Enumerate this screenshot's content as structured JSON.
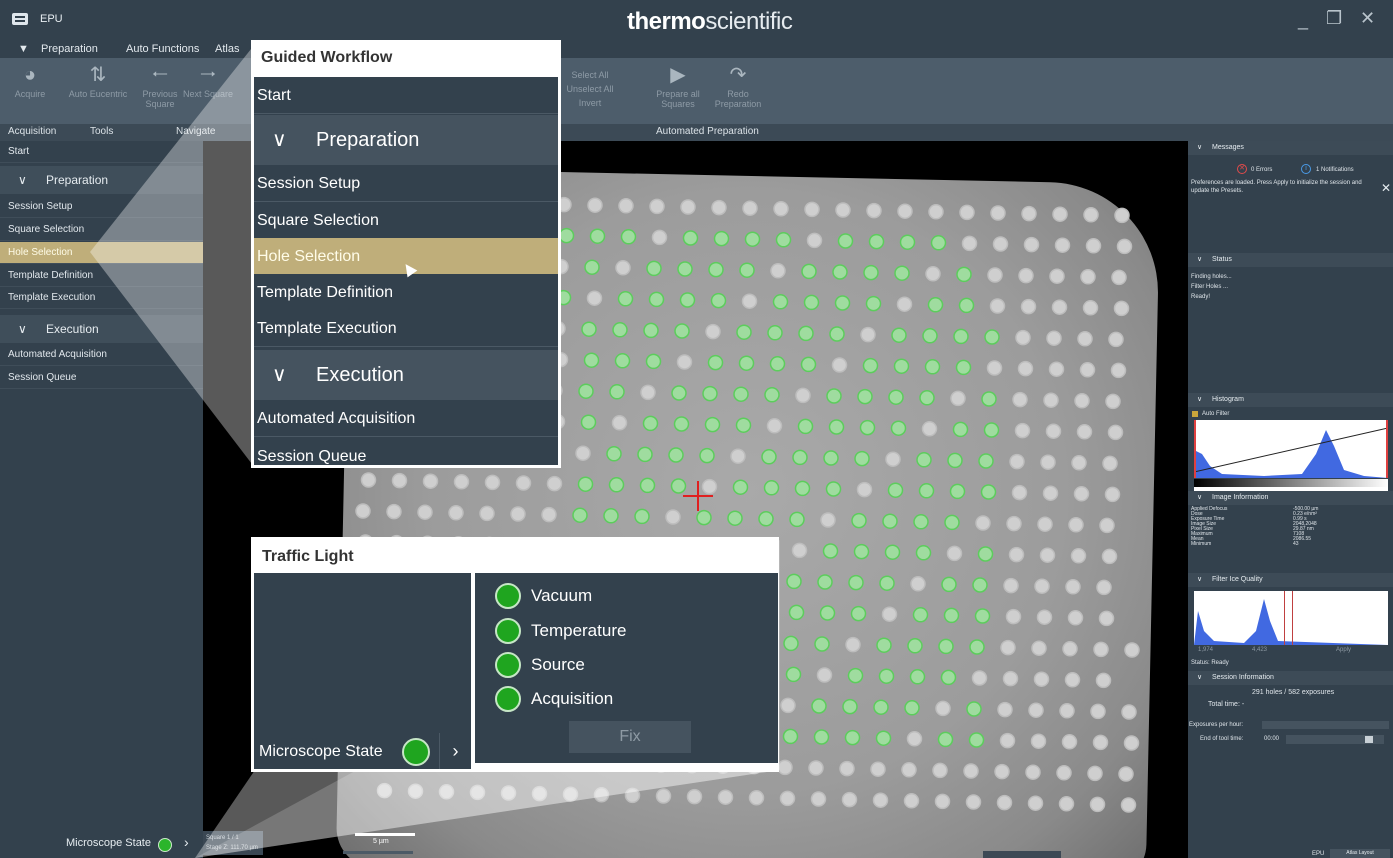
{
  "app": {
    "name": "EPU",
    "brand_bold": "thermo",
    "brand_light": "scientific"
  },
  "menu": [
    "Preparation",
    "Auto Functions",
    "Atlas"
  ],
  "ribbon": {
    "buttons": [
      {
        "label": "Acquire",
        "icon": "camera-icon"
      },
      {
        "label": "Auto Eucentric",
        "icon": "eucentric-icon"
      },
      {
        "label": "Previous Square",
        "icon": "arrow-left-icon"
      },
      {
        "label": "Next Square",
        "icon": "arrow-right-icon"
      }
    ],
    "hidden_buttons": [
      "Select All",
      "Unselect All",
      "Invert"
    ],
    "auto_buttons": [
      {
        "label": "Prepare all Squares",
        "icon": "play-icon"
      },
      {
        "label": "Redo Preparation",
        "icon": "redo-icon"
      }
    ],
    "groups": [
      "Acquisition",
      "Tools",
      "Navigate",
      "Automated Preparation"
    ]
  },
  "workflow": {
    "start": "Start",
    "preparation_header": "Preparation",
    "preparation_items": [
      "Session Setup",
      "Square Selection",
      "Hole Selection",
      "Template Definition",
      "Template Execution"
    ],
    "execution_header": "Execution",
    "execution_items": [
      "Automated Acquisition",
      "Session Queue"
    ],
    "active_item": "Hole Selection",
    "microscope_state": "Microscope State"
  },
  "viewer": {
    "square_info": "Square 1 / 1",
    "stage_z": "Stage Z: 111.70 µm",
    "scale": "5 µm"
  },
  "right_panel": {
    "messages_header": "Messages",
    "errors": "0 Errors",
    "notifications": "1 Notifications",
    "message_text": "Preferences are loaded. Press Apply to initialize the session and update the Presets.",
    "status_header": "Status",
    "status_lines": [
      "Finding holes...",
      "Filter Holes ...",
      "Ready!"
    ],
    "histogram_header": "Histogram",
    "auto_filter": "Auto Filter",
    "image_info_header": "Image Information",
    "image_info": [
      {
        "k": "Applied Defocus",
        "v": "-500.00 µm"
      },
      {
        "k": "Dose",
        "v": "0.23 e/nm²"
      },
      {
        "k": "Exposure Time",
        "v": "0.99 s"
      },
      {
        "k": "Image Size",
        "v": "2048,2048"
      },
      {
        "k": "Pixel Size",
        "v": "29.87 nm"
      },
      {
        "k": "Maximum",
        "v": "7108"
      },
      {
        "k": "Mean",
        "v": "2086.55"
      },
      {
        "k": "Minimum",
        "v": "43"
      }
    ],
    "filter_ice_header": "Filter Ice Quality",
    "ice_ticks": [
      "1,974",
      "4,423",
      "Apply"
    ],
    "status_ready": "Status: Ready",
    "session_info_header": "Session Information",
    "session_count": "291 holes / 582 exposures",
    "total_time": "Total time: -",
    "exposures_per_hour": "Exposures per hour:",
    "end_of_tool_time": "End of tool time:",
    "end_time_value": "00:00",
    "bottom_tab": "Atlas Layout",
    "bottom_left_tab": "EPU"
  },
  "callouts": {
    "guided_title": "Guided Workflow",
    "traffic_title": "Traffic Light",
    "traffic_items": [
      "Vacuum",
      "Temperature",
      "Source",
      "Acquisition"
    ],
    "fix": "Fix",
    "microscope_state": "Microscope State"
  }
}
